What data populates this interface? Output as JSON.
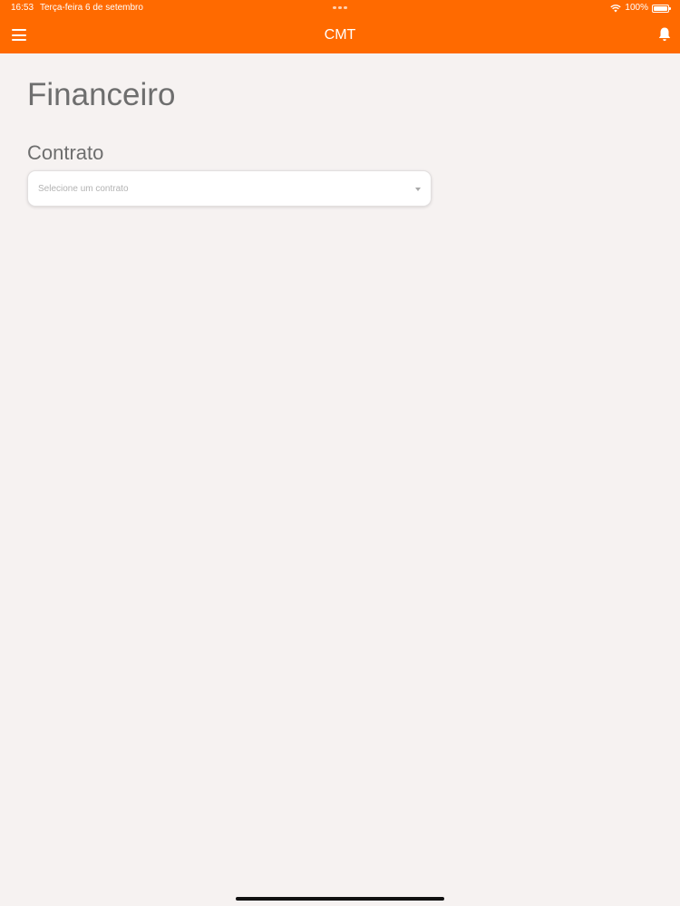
{
  "status_bar": {
    "time": "16:53",
    "date": "Terça-feira 6 de setembro",
    "battery": "100%",
    "icons": [
      "wifi-icon",
      "battery-icon"
    ]
  },
  "header": {
    "title": "CMT",
    "background_color": "#ff6a00",
    "icons": [
      "menu-icon",
      "bell-icon"
    ]
  },
  "page": {
    "title": "Financeiro",
    "contract_label": "Contrato",
    "contract_select": {
      "placeholder": "Selecione um contrato",
      "value": ""
    }
  }
}
